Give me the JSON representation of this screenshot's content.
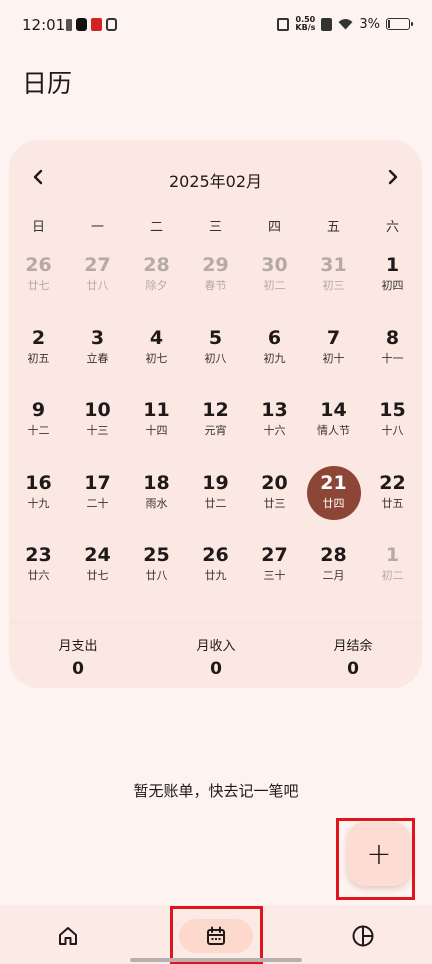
{
  "status_bar": {
    "time": "12:01",
    "net_speed_value": "0.50",
    "net_speed_unit": "KB/s",
    "battery": "3%"
  },
  "page_title": "日历",
  "calendar": {
    "month_label": "2025年02月",
    "weekdays": [
      "日",
      "一",
      "二",
      "三",
      "四",
      "五",
      "六"
    ],
    "weeks": [
      [
        {
          "day": "26",
          "lunar": "廿七",
          "muted": true
        },
        {
          "day": "27",
          "lunar": "廿八",
          "muted": true
        },
        {
          "day": "28",
          "lunar": "除夕",
          "muted": true
        },
        {
          "day": "29",
          "lunar": "春节",
          "muted": true
        },
        {
          "day": "30",
          "lunar": "初二",
          "muted": true
        },
        {
          "day": "31",
          "lunar": "初三",
          "muted": true
        },
        {
          "day": "1",
          "lunar": "初四",
          "muted": false
        }
      ],
      [
        {
          "day": "2",
          "lunar": "初五",
          "muted": false
        },
        {
          "day": "3",
          "lunar": "立春",
          "muted": false
        },
        {
          "day": "4",
          "lunar": "初七",
          "muted": false
        },
        {
          "day": "5",
          "lunar": "初八",
          "muted": false
        },
        {
          "day": "6",
          "lunar": "初九",
          "muted": false
        },
        {
          "day": "7",
          "lunar": "初十",
          "muted": false
        },
        {
          "day": "8",
          "lunar": "十一",
          "muted": false
        }
      ],
      [
        {
          "day": "9",
          "lunar": "十二",
          "muted": false
        },
        {
          "day": "10",
          "lunar": "十三",
          "muted": false
        },
        {
          "day": "11",
          "lunar": "十四",
          "muted": false
        },
        {
          "day": "12",
          "lunar": "元宵",
          "muted": false
        },
        {
          "day": "13",
          "lunar": "十六",
          "muted": false
        },
        {
          "day": "14",
          "lunar": "情人节",
          "muted": false
        },
        {
          "day": "15",
          "lunar": "十八",
          "muted": false
        }
      ],
      [
        {
          "day": "16",
          "lunar": "十九",
          "muted": false
        },
        {
          "day": "17",
          "lunar": "二十",
          "muted": false
        },
        {
          "day": "18",
          "lunar": "雨水",
          "muted": false
        },
        {
          "day": "19",
          "lunar": "廿二",
          "muted": false
        },
        {
          "day": "20",
          "lunar": "廿三",
          "muted": false
        },
        {
          "day": "21",
          "lunar": "廿四",
          "muted": false,
          "selected": true
        },
        {
          "day": "22",
          "lunar": "廿五",
          "muted": false
        }
      ],
      [
        {
          "day": "23",
          "lunar": "廿六",
          "muted": false
        },
        {
          "day": "24",
          "lunar": "廿七",
          "muted": false
        },
        {
          "day": "25",
          "lunar": "廿八",
          "muted": false
        },
        {
          "day": "26",
          "lunar": "廿九",
          "muted": false
        },
        {
          "day": "27",
          "lunar": "三十",
          "muted": false
        },
        {
          "day": "28",
          "lunar": "二月",
          "muted": false
        },
        {
          "day": "1",
          "lunar": "初二",
          "muted": true
        }
      ]
    ]
  },
  "summary": {
    "expense_label": "月支出",
    "expense_value": "0",
    "income_label": "月收入",
    "income_value": "0",
    "balance_label": "月结余",
    "balance_value": "0"
  },
  "empty_message": "暂无账单，快去记一笔吧",
  "fab_label": "+",
  "bottom_nav": {
    "items": [
      {
        "icon": "home-icon"
      },
      {
        "icon": "calendar-icon",
        "active": true
      },
      {
        "icon": "pie-chart-icon"
      }
    ]
  },
  "colors": {
    "background": "#fdf3f0",
    "card": "#fbe8e3",
    "selected_day": "#8d4636",
    "fab": "#fddcd3",
    "active_nav_pill": "#fdd8cd",
    "highlight_border": "#e0141c"
  }
}
